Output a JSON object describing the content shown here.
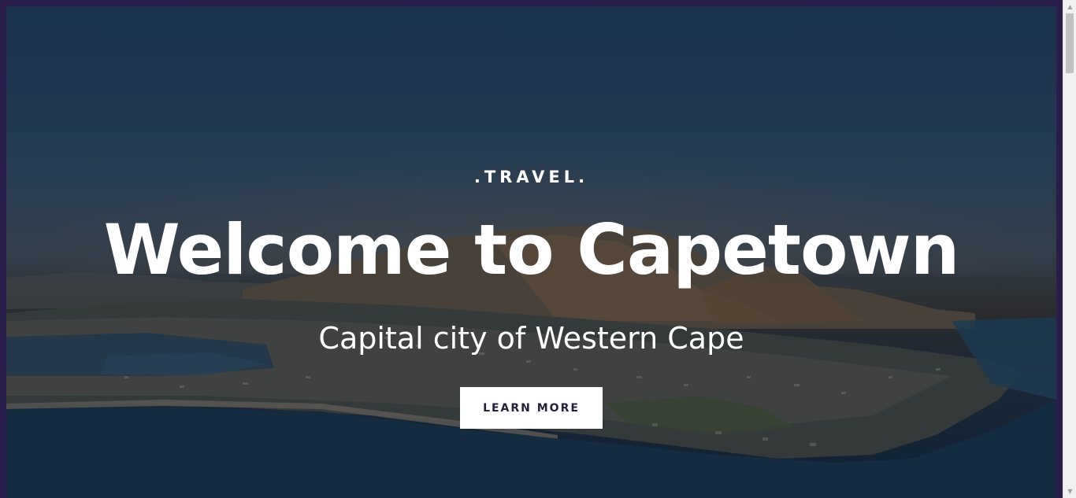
{
  "hero": {
    "eyebrow": ".TRAVEL.",
    "headline": "Welcome to Capetown",
    "subheadline": "Capital city of Western Cape",
    "cta_label": "LEARN MORE",
    "background_image": "aerial-city-coast-mountain",
    "overlay_color": "#0a1423"
  },
  "scrollbar": {
    "up_icon": "▲",
    "down_icon": "▼",
    "position": 0
  },
  "colors": {
    "frame": "#2a1f4a",
    "button_bg": "#ffffff",
    "button_text": "#23203a",
    "text": "#ffffff"
  }
}
